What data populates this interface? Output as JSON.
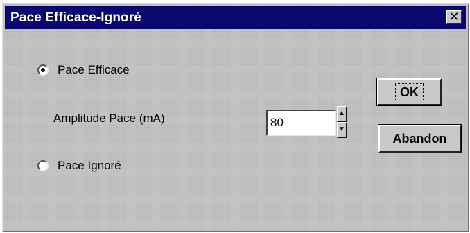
{
  "window": {
    "title": "Pace Efficace-Ignoré",
    "close_glyph": "✕"
  },
  "options": {
    "efficace_label": "Pace Efficace",
    "efficace_selected": true,
    "ignore_label": "Pace Ignoré",
    "ignore_selected": false
  },
  "amplitude": {
    "label": "Amplitude Pace (mA)",
    "value": "80"
  },
  "buttons": {
    "ok_label": "OK",
    "abandon_label": "Abandon"
  },
  "icons": {
    "spin_up": "▲",
    "spin_down": "▼"
  },
  "colors": {
    "titlebar": "#08086f",
    "dialog_bg": "#c3c3c3"
  }
}
